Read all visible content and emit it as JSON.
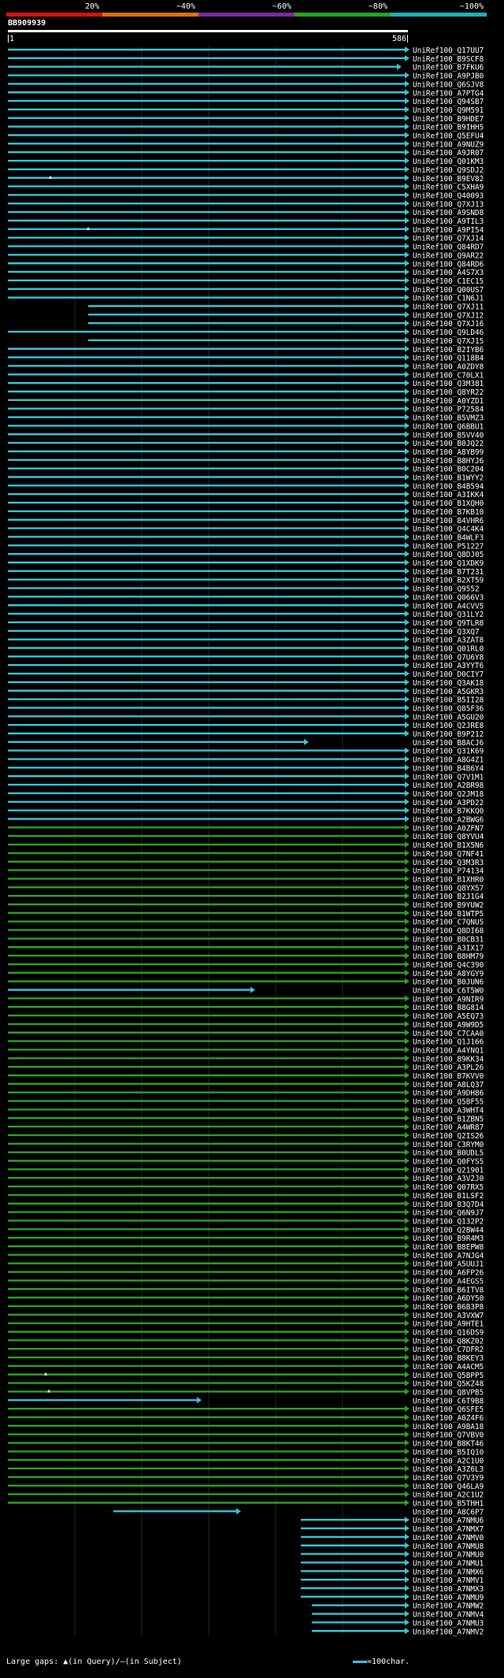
{
  "query_id": "BB909939",
  "query_start": "1",
  "query_end": "586",
  "scale_ticks": [
    "20%",
    "~40%",
    "~60%",
    "~80%",
    "~100%"
  ],
  "colors": {
    "background": "#000000",
    "cyan": "#38c4d8",
    "green": "#2aa21f",
    "red": "#d81010",
    "orange": "#e06e0a",
    "purple": "#7a2b9c",
    "teal": "#1fb0b8",
    "grid": "#2a3a1a"
  },
  "footer": {
    "gaps_label": "Large gaps: ",
    "query_gap_glyph": "▲",
    "query_gap_label": "(in Query)/",
    "subject_gap_glyph": "–",
    "subject_gap_label": "(in Subject)",
    "scale_label": "=100char."
  },
  "hits": [
    "UniRef100_Q17UU7",
    "UniRef100_B9SCF8",
    "UniRef100_B7FKU6",
    "UniRef100_A9PJB0",
    "UniRef100_Q6SJV8",
    "UniRef100_A7PTG4",
    "UniRef100_Q94SB7",
    "UniRef100_Q9M591",
    "UniRef100_B9HDE7",
    "UniRef100_B9IHH5",
    "UniRef100_Q5EFU4",
    "UniRef100_A9NUZ9",
    "UniRef100_A9JR07",
    "UniRef100_Q01KM3",
    "UniRef100_Q9SDJ2",
    "UniRef100_B9EV82",
    "UniRef100_C5XHA9",
    "UniRef100_Q40093",
    "UniRef100_Q7XJ13",
    "UniRef100_A9SND8",
    "UniRef100_A9TIL3",
    "UniRef100_A9PI54",
    "UniRef100_Q7XJ14",
    "UniRef100_Q84RD7",
    "UniRef100_Q9AR22",
    "UniRef100_Q84RD6",
    "UniRef100_A4S7X3",
    "UniRef100_C1EC15",
    "UniRef100_Q00US7",
    "UniRef100_C1N6J1",
    "UniRef100_Q7XJ11",
    "UniRef100_Q7XJ12",
    "UniRef100_Q7XJ16",
    "UniRef100_Q9LD46",
    "UniRef100_Q7XJ15",
    "UniRef100_B2IYB6",
    "UniRef100_Q118B4",
    "UniRef100_A0ZDY8",
    "UniRef100_C70LX1",
    "UniRef100_Q3M381",
    "UniRef100_Q8YR22",
    "UniRef100_A0YZD1",
    "UniRef100_P72584",
    "UniRef100_B5VMZ3",
    "UniRef100_Q6BBU1",
    "UniRef100_B5VV40",
    "UniRef100_B0JQ22",
    "UniRef100_A8YB99",
    "UniRef100_B8HYJ6",
    "UniRef100_B0C204",
    "UniRef100_B1WYY2",
    "UniRef100_B4B594",
    "UniRef100_A3IKK4",
    "UniRef100_B1XQH0",
    "UniRef100_B7KB10",
    "UniRef100_B4VHR6",
    "UniRef100_Q4C4K4",
    "UniRef100_B4WLF3",
    "UniRef100_P51227",
    "UniRef100_Q8DJ05",
    "UniRef100_Q1XDK9",
    "UniRef100_B7T231",
    "UniRef100_B2XT59",
    "UniRef100_Q9552",
    "UniRef100_Q066V3",
    "UniRef100_A4CVV5",
    "UniRef100_Q31LY2",
    "UniRef100_Q9TLR8",
    "UniRef100_Q3XQ7",
    "UniRef100_A3ZAT8",
    "UniRef100_Q01RL0",
    "UniRef100_Q7U6Y8",
    "UniRef100_A3YYT6",
    "UniRef100_D0CIY7",
    "UniRef100_Q3AK18",
    "UniRef100_A5GKR3",
    "UniRef100_B5II28",
    "UniRef100_Q85F36",
    "UniRef100_A5GU20",
    "UniRef100_Q2JRE8",
    "UniRef100_B9P212",
    "UniRef100_B8ACJ6",
    "UniRef100_Q31K69",
    "UniRef100_A8G4Z1",
    "UniRef100_B4B6Y4",
    "UniRef100_Q7V1M1",
    "UniRef100_A2BR98",
    "UniRef100_Q2JM18",
    "UniRef100_A3PD22",
    "UniRef100_B7KKQ0",
    "UniRef100_A2BWG6",
    "UniRef100_A0ZFN7",
    "UniRef100_Q8YVU4",
    "UniRef100_B1X5N6",
    "UniRef100_Q7NF41",
    "UniRef100_Q3M3R3",
    "UniRef100_P74134",
    "UniRef100_B1XHR0",
    "UniRef100_Q8YX57",
    "UniRef100_B2J1G4",
    "UniRef100_B9YUW2",
    "UniRef100_B1WTP5",
    "UniRef100_C7QNU5",
    "UniRef100_Q8DI68",
    "UniRef100_B0CB31",
    "UniRef100_A3IX17",
    "UniRef100_B8HM79",
    "UniRef100_Q4C390",
    "UniRef100_A8YGY9",
    "UniRef100_B0JUN6",
    "UniRef100_C6T5W0",
    "UniRef100_A9NIR9",
    "UniRef100_B8G814",
    "UniRef100_A5EQ73",
    "UniRef100_A9W9D5",
    "UniRef100_C7CAA0",
    "UniRef100_Q1J166",
    "UniRef100_A4YNQ1",
    "UniRef100_B9KK34",
    "UniRef100_A3PL26",
    "UniRef100_B7KVV0",
    "UniRef100_A8LQ37",
    "UniRef100_A9DH86",
    "UniRef100_Q5BF55",
    "UniRef100_A3WHT4",
    "UniRef100_B1ZBN5",
    "UniRef100_A4WR87",
    "UniRef100_Q2IS26",
    "UniRef100_C3RYM0",
    "UniRef100_B0UDL5",
    "UniRef100_Q0FYS5",
    "UniRef100_Q21901",
    "UniRef100_A3V2J0",
    "UniRef100_Q07RX5",
    "UniRef100_B1LSF2",
    "UniRef100_B3Q7D4",
    "UniRef100_Q6N9J7",
    "UniRef100_Q132P2",
    "UniRef100_Q2BW44",
    "UniRef100_B9R4M3",
    "UniRef100_B8EPW8",
    "UniRef100_A7NJG4",
    "UniRef100_A5UUJ1",
    "UniRef100_A6FP26",
    "UniRef100_A4EGS5",
    "UniRef100_B6ITV8",
    "UniRef100_A6DY50",
    "UniRef100_B6B3P8",
    "UniRef100_A3VXW7",
    "UniRef100_A9HTE1",
    "UniRef100_Q16DS9",
    "UniRef100_Q8KZ02",
    "UniRef100_C7DFR2",
    "UniRef100_B8KEY3",
    "UniRef100_A4ACM5",
    "UniRef100_Q5BPP5",
    "UniRef100_Q5KZ48",
    "UniRef100_Q8VPB5",
    "UniRef100_C6T9B8",
    "UniRef100_Q6SFE5",
    "UniRef100_A0Z4F6",
    "UniRef100_A9BA18",
    "UniRef100_Q7VBV0",
    "UniRef100_B8KT46",
    "UniRef100_B5IQ10",
    "UniRef100_A2C1U0",
    "UniRef100_A3Z6L3",
    "UniRef100_Q7V3Y9",
    "UniRef100_Q46LA9",
    "UniRef100_A2C1U2",
    "UniRef100_B5THH1",
    "UniRef100_A8C6P7",
    "UniRef100_A7NMU6",
    "UniRef100_A7NMX7",
    "UniRef100_A7NMV0",
    "UniRef100_A7NMU8",
    "UniRef100_A7NMU0",
    "UniRef100_A7NMU1",
    "UniRef100_A7NMX6",
    "UniRef100_A7NMV1",
    "UniRef100_A7NMX3",
    "UniRef100_A7NMU9",
    "UniRef100_A7NMW2",
    "UniRef100_A7NMV4",
    "UniRef100_A7NMU3",
    "UniRef100_A7NMV2"
  ]
}
